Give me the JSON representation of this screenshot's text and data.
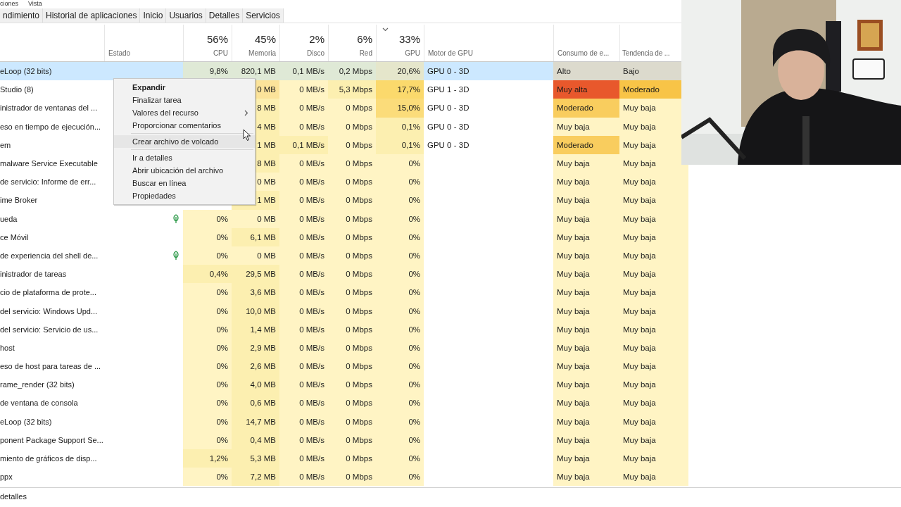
{
  "menu_bar": [
    "ciones",
    "Vista"
  ],
  "tabs": [
    {
      "label": "ndimiento",
      "selected": false
    },
    {
      "label": "Historial de aplicaciones",
      "selected": false
    },
    {
      "label": "Inicio",
      "selected": false
    },
    {
      "label": "Usuarios",
      "selected": false
    },
    {
      "label": "Detalles",
      "selected": false
    },
    {
      "label": "Servicios",
      "selected": false
    }
  ],
  "columns": [
    {
      "kind": "name"
    },
    {
      "kind": "text",
      "label": "Estado",
      "sorted": false
    },
    {
      "kind": "metric",
      "label": "CPU",
      "total": "56%",
      "sorted": false
    },
    {
      "kind": "metric",
      "label": "Memoria",
      "total": "45%",
      "sorted": false
    },
    {
      "kind": "metric",
      "label": "Disco",
      "total": "2%",
      "sorted": false
    },
    {
      "kind": "metric",
      "label": "Red",
      "total": "6%",
      "sorted": false
    },
    {
      "kind": "metric",
      "label": "GPU",
      "total": "33%",
      "sorted": true
    },
    {
      "kind": "text",
      "label": "Motor de GPU",
      "sorted": false
    },
    {
      "kind": "text",
      "label": "Consumo de e...",
      "sorted": false
    },
    {
      "kind": "text",
      "label": "Tendencia de ...",
      "sorted": false
    }
  ],
  "rows": [
    {
      "name": "eLoop (32 bits)",
      "selected": true,
      "eco": false,
      "metrics": [
        {
          "text": "9,8%",
          "color": "#dfe9d6"
        },
        {
          "text": "820,1 MB",
          "color": "#dfe9d6"
        },
        {
          "text": "0,1 MB/s",
          "color": "#dfe9d6"
        },
        {
          "text": "0,2 Mbps",
          "color": "#dfe9d6"
        },
        {
          "text": "20,6%",
          "color": "#e5e6cb"
        }
      ],
      "gpu_engine": "GPU 0 - 3D",
      "power": {
        "text": "Alto",
        "color": "#dcdacd"
      },
      "trend": {
        "text": "Bajo",
        "color": "#dcdacd"
      }
    },
    {
      "name": "Studio (8)",
      "selected": false,
      "metrics": [
        {
          "text": "0 MB",
          "color": "#fbe39a"
        },
        {
          "text": "0 MB/s",
          "color": "#fff4c4"
        },
        {
          "text": "5,3 Mbps",
          "color": "#fcefb0"
        },
        {
          "text": "17,7%",
          "color": "#fbd96c"
        }
      ],
      "gpu_engine": "GPU 1 - 3D",
      "power": {
        "text": "Muy alta",
        "color": "#e8582c"
      },
      "trend": {
        "text": "Moderado",
        "color": "#f8c447"
      }
    },
    {
      "name": "inistrador de ventanas del ...",
      "selected": false,
      "metrics": [
        {
          "text": "8 MB",
          "color": "#fcefb0"
        },
        {
          "text": "0 MB/s",
          "color": "#fff4c4"
        },
        {
          "text": "0 Mbps",
          "color": "#fff4c4"
        },
        {
          "text": "15,0%",
          "color": "#fbdc7a"
        }
      ],
      "gpu_engine": "GPU 0 - 3D",
      "power": {
        "text": "Moderado",
        "color": "#f9cd5e"
      },
      "trend": {
        "text": "Muy baja",
        "color": "#fff4c4"
      }
    },
    {
      "name": "eso en tiempo de ejecución...",
      "selected": false,
      "metrics": [
        {
          "text": "4 MB",
          "color": "#fcefb0"
        },
        {
          "text": "0 MB/s",
          "color": "#fff4c4"
        },
        {
          "text": "0 Mbps",
          "color": "#fff4c4"
        },
        {
          "text": "0,1%",
          "color": "#fcefb0"
        }
      ],
      "gpu_engine": "GPU 0 - 3D",
      "power": {
        "text": "Muy baja",
        "color": "#fff4c4"
      },
      "trend": {
        "text": "Muy baja",
        "color": "#fff4c4"
      }
    },
    {
      "name": "em",
      "selected": false,
      "metrics": [
        {
          "text": "1 MB",
          "color": "#fcefb0"
        },
        {
          "text": "0,1 MB/s",
          "color": "#fcefb0"
        },
        {
          "text": "0 Mbps",
          "color": "#fff4c4"
        },
        {
          "text": "0,1%",
          "color": "#fcefb0"
        }
      ],
      "gpu_engine": "GPU 0 - 3D",
      "power": {
        "text": "Moderado",
        "color": "#f9cd5e"
      },
      "trend": {
        "text": "Muy baja",
        "color": "#fff4c4"
      }
    },
    {
      "name": "malware Service Executable",
      "selected": false,
      "metrics": [
        {
          "text": "8 MB",
          "color": "#fcefb0"
        },
        {
          "text": "0 MB/s",
          "color": "#fff4c4"
        },
        {
          "text": "0 Mbps",
          "color": "#fff4c4"
        },
        {
          "text": "0%",
          "color": "#fff4c4"
        }
      ],
      "power": {
        "text": "Muy baja",
        "color": "#fff4c4"
      },
      "trend": {
        "text": "Muy baja",
        "color": "#fff4c4"
      }
    },
    {
      "name": "de servicio: Informe de err...",
      "selected": false,
      "metrics": [
        {
          "text": "0 MB",
          "color": "#fff4c4"
        },
        {
          "text": "0 MB/s",
          "color": "#fff4c4"
        },
        {
          "text": "0 Mbps",
          "color": "#fff4c4"
        },
        {
          "text": "0%",
          "color": "#fff4c4"
        }
      ],
      "power": {
        "text": "Muy baja",
        "color": "#fff4c4"
      },
      "trend": {
        "text": "Muy baja",
        "color": "#fff4c4"
      }
    },
    {
      "name": "ime Broker",
      "selected": false,
      "metrics": [
        {
          "text": "1 MB",
          "color": "#fcefb0"
        },
        {
          "text": "0 MB/s",
          "color": "#fff4c4"
        },
        {
          "text": "0 Mbps",
          "color": "#fff4c4"
        },
        {
          "text": "0%",
          "color": "#fff4c4"
        }
      ],
      "power": {
        "text": "Muy baja",
        "color": "#fff4c4"
      },
      "trend": {
        "text": "Muy baja",
        "color": "#fff4c4"
      }
    },
    {
      "name": "ueda",
      "selected": false,
      "eco": true,
      "metrics": [
        {
          "text": "0%",
          "color": "#fff4c4"
        },
        {
          "text": "0 MB",
          "color": "#fff4c4"
        },
        {
          "text": "0 MB/s",
          "color": "#fff4c4"
        },
        {
          "text": "0 Mbps",
          "color": "#fff4c4"
        },
        {
          "text": "0%",
          "color": "#fff4c4"
        }
      ],
      "power": {
        "text": "Muy baja",
        "color": "#fff4c4"
      },
      "trend": {
        "text": "Muy baja",
        "color": "#fff4c4"
      }
    },
    {
      "name": "ce Móvil",
      "selected": false,
      "eco": false,
      "metrics": [
        {
          "text": "0%",
          "color": "#fff4c4"
        },
        {
          "text": "6,1 MB",
          "color": "#fcefb0"
        },
        {
          "text": "0 MB/s",
          "color": "#fff4c4"
        },
        {
          "text": "0 Mbps",
          "color": "#fff4c4"
        },
        {
          "text": "0%",
          "color": "#fff4c4"
        }
      ],
      "power": {
        "text": "Muy baja",
        "color": "#fff4c4"
      },
      "trend": {
        "text": "Muy baja",
        "color": "#fff4c4"
      }
    },
    {
      "name": "de experiencia del shell de...",
      "selected": false,
      "eco": true,
      "metrics": [
        {
          "text": "0%",
          "color": "#fff4c4"
        },
        {
          "text": "0 MB",
          "color": "#fff4c4"
        },
        {
          "text": "0 MB/s",
          "color": "#fff4c4"
        },
        {
          "text": "0 Mbps",
          "color": "#fff4c4"
        },
        {
          "text": "0%",
          "color": "#fff4c4"
        }
      ],
      "power": {
        "text": "Muy baja",
        "color": "#fff4c4"
      },
      "trend": {
        "text": "Muy baja",
        "color": "#fff4c4"
      }
    },
    {
      "name": "inistrador de tareas",
      "selected": false,
      "eco": false,
      "metrics": [
        {
          "text": "0,4%",
          "color": "#fcefb0"
        },
        {
          "text": "29,5 MB",
          "color": "#fcefb0"
        },
        {
          "text": "0 MB/s",
          "color": "#fff4c4"
        },
        {
          "text": "0 Mbps",
          "color": "#fff4c4"
        },
        {
          "text": "0%",
          "color": "#fff4c4"
        }
      ],
      "power": {
        "text": "Muy baja",
        "color": "#fff4c4"
      },
      "trend": {
        "text": "Muy baja",
        "color": "#fff4c4"
      }
    },
    {
      "name": "cio de plataforma de prote...",
      "selected": false,
      "eco": false,
      "metrics": [
        {
          "text": "0%",
          "color": "#fff4c4"
        },
        {
          "text": "3,6 MB",
          "color": "#fcefb0"
        },
        {
          "text": "0 MB/s",
          "color": "#fff4c4"
        },
        {
          "text": "0 Mbps",
          "color": "#fff4c4"
        },
        {
          "text": "0%",
          "color": "#fff4c4"
        }
      ],
      "power": {
        "text": "Muy baja",
        "color": "#fff4c4"
      },
      "trend": {
        "text": "Muy baja",
        "color": "#fff4c4"
      }
    },
    {
      "name": "del servicio: Windows Upd...",
      "selected": false,
      "eco": false,
      "metrics": [
        {
          "text": "0%",
          "color": "#fff4c4"
        },
        {
          "text": "10,0 MB",
          "color": "#fcefb0"
        },
        {
          "text": "0 MB/s",
          "color": "#fff4c4"
        },
        {
          "text": "0 Mbps",
          "color": "#fff4c4"
        },
        {
          "text": "0%",
          "color": "#fff4c4"
        }
      ],
      "power": {
        "text": "Muy baja",
        "color": "#fff4c4"
      },
      "trend": {
        "text": "Muy baja",
        "color": "#fff4c4"
      }
    },
    {
      "name": "del servicio: Servicio de us...",
      "selected": false,
      "eco": false,
      "metrics": [
        {
          "text": "0%",
          "color": "#fff4c4"
        },
        {
          "text": "1,4 MB",
          "color": "#fcefb0"
        },
        {
          "text": "0 MB/s",
          "color": "#fff4c4"
        },
        {
          "text": "0 Mbps",
          "color": "#fff4c4"
        },
        {
          "text": "0%",
          "color": "#fff4c4"
        }
      ],
      "power": {
        "text": "Muy baja",
        "color": "#fff4c4"
      },
      "trend": {
        "text": "Muy baja",
        "color": "#fff4c4"
      }
    },
    {
      "name": "host",
      "selected": false,
      "eco": false,
      "metrics": [
        {
          "text": "0%",
          "color": "#fff4c4"
        },
        {
          "text": "2,9 MB",
          "color": "#fcefb0"
        },
        {
          "text": "0 MB/s",
          "color": "#fff4c4"
        },
        {
          "text": "0 Mbps",
          "color": "#fff4c4"
        },
        {
          "text": "0%",
          "color": "#fff4c4"
        }
      ],
      "power": {
        "text": "Muy baja",
        "color": "#fff4c4"
      },
      "trend": {
        "text": "Muy baja",
        "color": "#fff4c4"
      }
    },
    {
      "name": "eso de host para tareas de ...",
      "selected": false,
      "eco": false,
      "metrics": [
        {
          "text": "0%",
          "color": "#fff4c4"
        },
        {
          "text": "2,6 MB",
          "color": "#fcefb0"
        },
        {
          "text": "0 MB/s",
          "color": "#fff4c4"
        },
        {
          "text": "0 Mbps",
          "color": "#fff4c4"
        },
        {
          "text": "0%",
          "color": "#fff4c4"
        }
      ],
      "power": {
        "text": "Muy baja",
        "color": "#fff4c4"
      },
      "trend": {
        "text": "Muy baja",
        "color": "#fff4c4"
      }
    },
    {
      "name": "rame_render (32 bits)",
      "selected": false,
      "eco": false,
      "metrics": [
        {
          "text": "0%",
          "color": "#fff4c4"
        },
        {
          "text": "4,0 MB",
          "color": "#fcefb0"
        },
        {
          "text": "0 MB/s",
          "color": "#fff4c4"
        },
        {
          "text": "0 Mbps",
          "color": "#fff4c4"
        },
        {
          "text": "0%",
          "color": "#fff4c4"
        }
      ],
      "power": {
        "text": "Muy baja",
        "color": "#fff4c4"
      },
      "trend": {
        "text": "Muy baja",
        "color": "#fff4c4"
      }
    },
    {
      "name": "de ventana de consola",
      "selected": false,
      "eco": false,
      "metrics": [
        {
          "text": "0%",
          "color": "#fff4c4"
        },
        {
          "text": "0,6 MB",
          "color": "#fcefb0"
        },
        {
          "text": "0 MB/s",
          "color": "#fff4c4"
        },
        {
          "text": "0 Mbps",
          "color": "#fff4c4"
        },
        {
          "text": "0%",
          "color": "#fff4c4"
        }
      ],
      "power": {
        "text": "Muy baja",
        "color": "#fff4c4"
      },
      "trend": {
        "text": "Muy baja",
        "color": "#fff4c4"
      }
    },
    {
      "name": "eLoop (32 bits)",
      "selected": false,
      "eco": false,
      "metrics": [
        {
          "text": "0%",
          "color": "#fff4c4"
        },
        {
          "text": "14,7 MB",
          "color": "#fcefb0"
        },
        {
          "text": "0 MB/s",
          "color": "#fff4c4"
        },
        {
          "text": "0 Mbps",
          "color": "#fff4c4"
        },
        {
          "text": "0%",
          "color": "#fff4c4"
        }
      ],
      "power": {
        "text": "Muy baja",
        "color": "#fff4c4"
      },
      "trend": {
        "text": "Muy baja",
        "color": "#fff4c4"
      }
    },
    {
      "name": "ponent Package Support Se...",
      "selected": false,
      "eco": false,
      "metrics": [
        {
          "text": "0%",
          "color": "#fff4c4"
        },
        {
          "text": "0,4 MB",
          "color": "#fcefb0"
        },
        {
          "text": "0 MB/s",
          "color": "#fff4c4"
        },
        {
          "text": "0 Mbps",
          "color": "#fff4c4"
        },
        {
          "text": "0%",
          "color": "#fff4c4"
        }
      ],
      "power": {
        "text": "Muy baja",
        "color": "#fff4c4"
      },
      "trend": {
        "text": "Muy baja",
        "color": "#fff4c4"
      }
    },
    {
      "name": "miento de gráficos de disp...",
      "selected": false,
      "eco": false,
      "metrics": [
        {
          "text": "1,2%",
          "color": "#fcefb0"
        },
        {
          "text": "5,3 MB",
          "color": "#fcefb0"
        },
        {
          "text": "0 MB/s",
          "color": "#fff4c4"
        },
        {
          "text": "0 Mbps",
          "color": "#fff4c4"
        },
        {
          "text": "0%",
          "color": "#fff4c4"
        }
      ],
      "power": {
        "text": "Muy baja",
        "color": "#fff4c4"
      },
      "trend": {
        "text": "Muy baja",
        "color": "#fff4c4"
      }
    },
    {
      "name": "ppx",
      "selected": false,
      "eco": false,
      "metrics": [
        {
          "text": "0%",
          "color": "#fff4c4"
        },
        {
          "text": "7,2 MB",
          "color": "#fcefb0"
        },
        {
          "text": "0 MB/s",
          "color": "#fff4c4"
        },
        {
          "text": "0 Mbps",
          "color": "#fff4c4"
        },
        {
          "text": "0%",
          "color": "#fff4c4"
        }
      ],
      "power": {
        "text": "Muy baja",
        "color": "#fff4c4"
      },
      "trend": {
        "text": "Muy baja",
        "color": "#fff4c4"
      }
    }
  ],
  "context_menu": [
    {
      "kind": "default",
      "label": "Expandir",
      "selected": false
    },
    {
      "kind": "item",
      "label": "Finalizar tarea",
      "selected": false
    },
    {
      "kind": "submenu",
      "label": "Valores del recurso",
      "selected": false
    },
    {
      "kind": "item",
      "label": "Proporcionar comentarios",
      "selected": false
    },
    {
      "kind": "separator"
    },
    {
      "kind": "item",
      "label": "Crear archivo de volcado",
      "selected": true
    },
    {
      "kind": "separator"
    },
    {
      "kind": "item",
      "label": "Ir a detalles",
      "selected": false
    },
    {
      "kind": "item",
      "label": "Abrir ubicación del archivo",
      "selected": false
    },
    {
      "kind": "item",
      "label": "Buscar en línea",
      "selected": false
    },
    {
      "kind": "item",
      "label": "Propiedades",
      "selected": false
    }
  ],
  "footer": {
    "toggle": "detalles"
  }
}
